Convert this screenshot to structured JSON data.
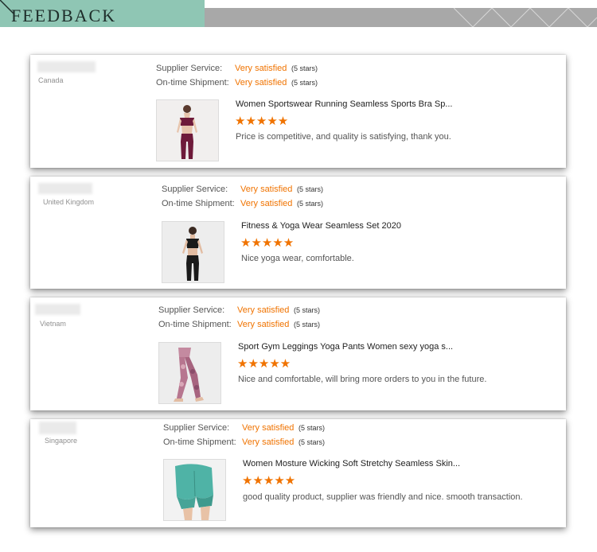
{
  "header": {
    "title": "FEEDBACK"
  },
  "reviews": [
    {
      "country": "Canada",
      "supplier_service_label": "Supplier Service:",
      "supplier_service_value": "Very satisfied",
      "supplier_service_stars": "(5 stars)",
      "shipment_label": "On-time Shipment:",
      "shipment_value": "Very satisfied",
      "shipment_stars": "(5 stars)",
      "product_title": "Women Sportswear Running Seamless Sports Bra Sp...",
      "rating": 5,
      "stars_text": "★★★★★",
      "comment": "Price is competitive, and quality is satisfying, thank you.",
      "image_icon": "sports-bra-set-photo"
    },
    {
      "country": "United Kingdom",
      "supplier_service_label": "Supplier Service:",
      "supplier_service_value": "Very satisfied",
      "supplier_service_stars": "(5 stars)",
      "shipment_label": "On-time Shipment:",
      "shipment_value": "Very satisfied",
      "shipment_stars": "(5 stars)",
      "product_title": "Fitness & Yoga Wear Seamless Set 2020",
      "rating": 5,
      "stars_text": "★★★★★",
      "comment": "Nice yoga wear, comfortable.",
      "image_icon": "yoga-set-photo"
    },
    {
      "country": "Vietnam",
      "supplier_service_label": "Supplier Service:",
      "supplier_service_value": "Very satisfied",
      "supplier_service_stars": "(5 stars)",
      "shipment_label": "On-time Shipment:",
      "shipment_value": "Very satisfied",
      "shipment_stars": "(5 stars)",
      "product_title": "Sport Gym Leggings Yoga Pants Women sexy yoga s...",
      "rating": 5,
      "stars_text": "★★★★★",
      "comment": "Nice and comfortable, will bring more orders to you in the future.",
      "image_icon": "leggings-photo"
    },
    {
      "country": "Singapore",
      "supplier_service_label": "Supplier Service:",
      "supplier_service_value": "Very satisfied",
      "supplier_service_stars": "(5 stars)",
      "shipment_label": "On-time Shipment:",
      "shipment_value": "Very satisfied",
      "shipment_stars": "(5 stars)",
      "product_title": "Women Mosture Wicking Soft Stretchy Seamless Skin...",
      "rating": 5,
      "stars_text": "★★★★★",
      "comment": "good quality product, supplier was friendly and nice. smooth transaction.",
      "image_icon": "biker-shorts-photo"
    }
  ],
  "colors": {
    "accent": "#f07300",
    "banner_teal": "#8fc6b4",
    "banner_gray": "#a8a8a8"
  }
}
